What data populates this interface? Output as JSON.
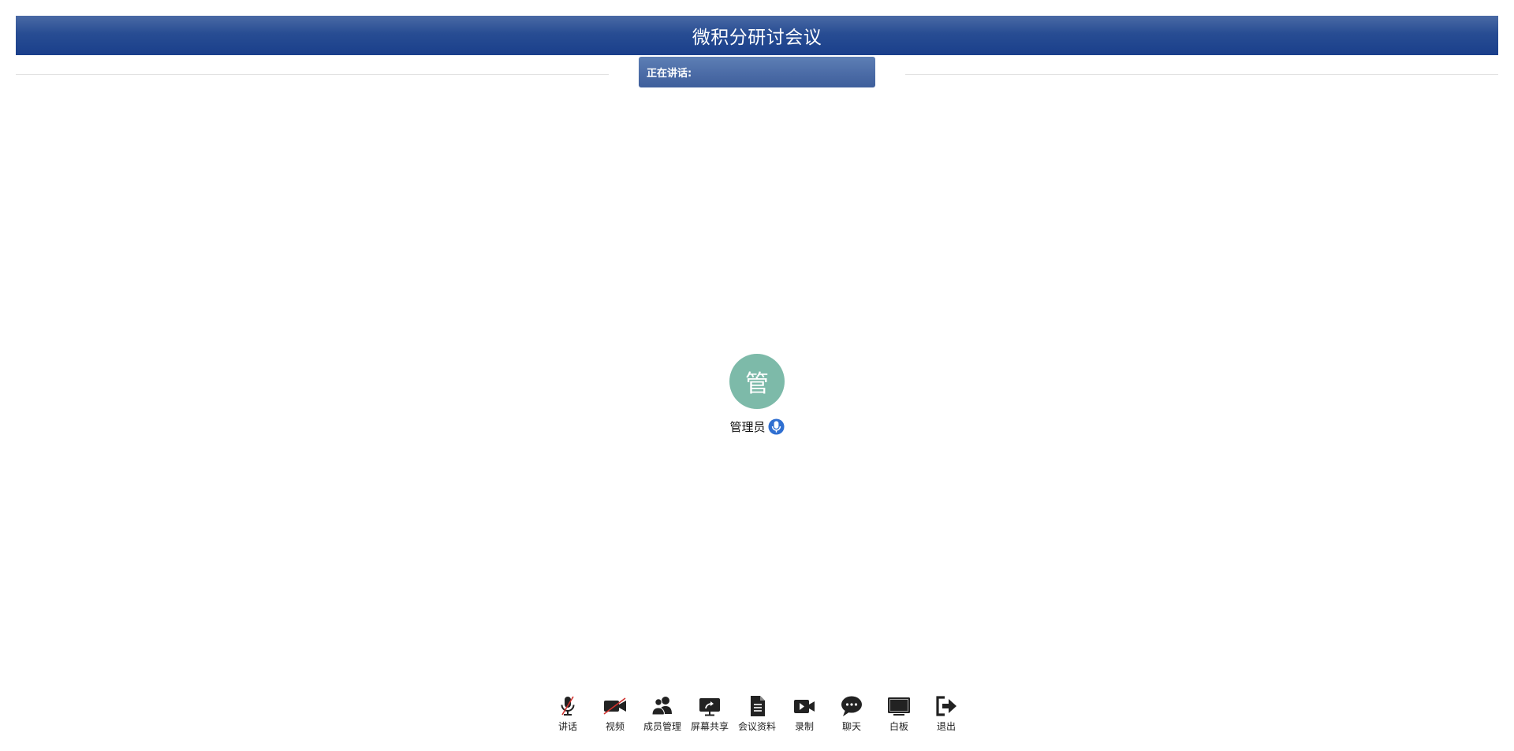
{
  "header": {
    "title": "微积分研讨会议"
  },
  "speaking": {
    "label": "正在讲话:"
  },
  "participant": {
    "avatar_char": "管",
    "name": "管理员",
    "avatar_color": "#7dbaa9",
    "mic_status_color": "#2f6fd1"
  },
  "toolbar": {
    "items": [
      {
        "label": "讲话",
        "icon": "mic-off-icon"
      },
      {
        "label": "视频",
        "icon": "video-off-icon"
      },
      {
        "label": "成员管理",
        "icon": "users-icon"
      },
      {
        "label": "屏幕共享",
        "icon": "screen-share-icon"
      },
      {
        "label": "会议资料",
        "icon": "document-icon"
      },
      {
        "label": "录制",
        "icon": "record-icon"
      },
      {
        "label": "聊天",
        "icon": "chat-icon"
      },
      {
        "label": "白板",
        "icon": "whiteboard-icon"
      },
      {
        "label": "退出",
        "icon": "exit-icon"
      }
    ]
  },
  "colors": {
    "header_dark": "#1a3f8b",
    "header_light": "#4a6aa5",
    "icon_color": "#222222",
    "muted_slash": "#d0312d"
  }
}
